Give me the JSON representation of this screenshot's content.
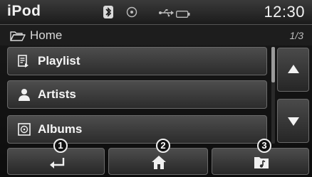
{
  "status_bar": {
    "app_title": "iPod",
    "clock": "12:30",
    "icons": [
      "bluetooth-icon",
      "disc-icon",
      "usb-icon",
      "battery-icon"
    ]
  },
  "path_bar": {
    "folder_icon": "folder-icon",
    "label": "Home",
    "page": "1/3"
  },
  "list": {
    "items": [
      {
        "label": "Playlist",
        "icon": "playlist-icon"
      },
      {
        "label": "Artists",
        "icon": "artist-icon"
      },
      {
        "label": "Albums",
        "icon": "album-icon"
      }
    ]
  },
  "scroll": {
    "up_icon": "triangle-up-icon",
    "down_icon": "triangle-down-icon"
  },
  "bottom_bar": {
    "buttons": [
      {
        "callout": "1",
        "icon": "return-icon"
      },
      {
        "callout": "2",
        "icon": "home-icon"
      },
      {
        "callout": "3",
        "icon": "music-folder-icon"
      }
    ]
  },
  "colors": {
    "background": "#0d0d0d",
    "button_face": "#3a3a3a",
    "text": "#f5f5f5"
  }
}
